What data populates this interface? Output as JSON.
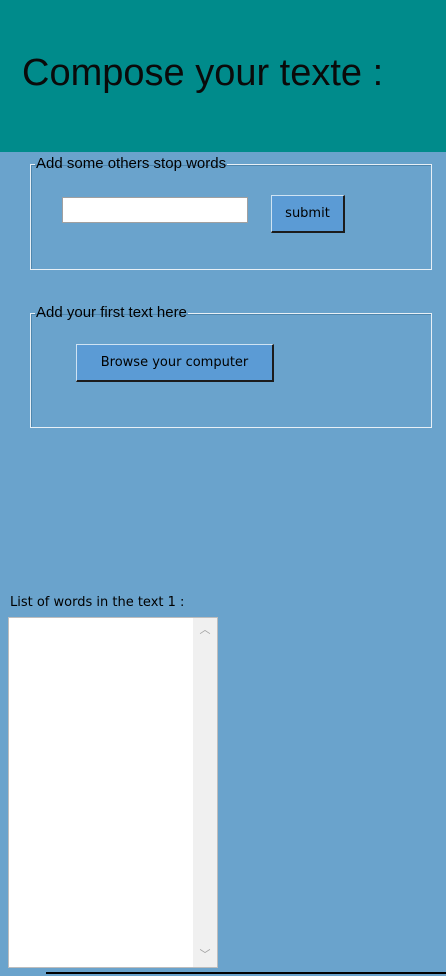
{
  "header": {
    "title": "Compose your texte :"
  },
  "stop_words_group": {
    "legend": "Add some others stop words",
    "input_value": "",
    "submit_label": "submit"
  },
  "first_text_group": {
    "legend": "Add your first text here",
    "browse_label": "Browse your computer"
  },
  "words_list": {
    "label": "List of words in the text 1 :",
    "items": []
  },
  "icons": {
    "scroll_up": "scroll-up-arrow",
    "scroll_down": "scroll-down-arrow"
  },
  "colors": {
    "background": "#6aa3cc",
    "header": "#008b8b",
    "button": "#5b9bd5"
  }
}
